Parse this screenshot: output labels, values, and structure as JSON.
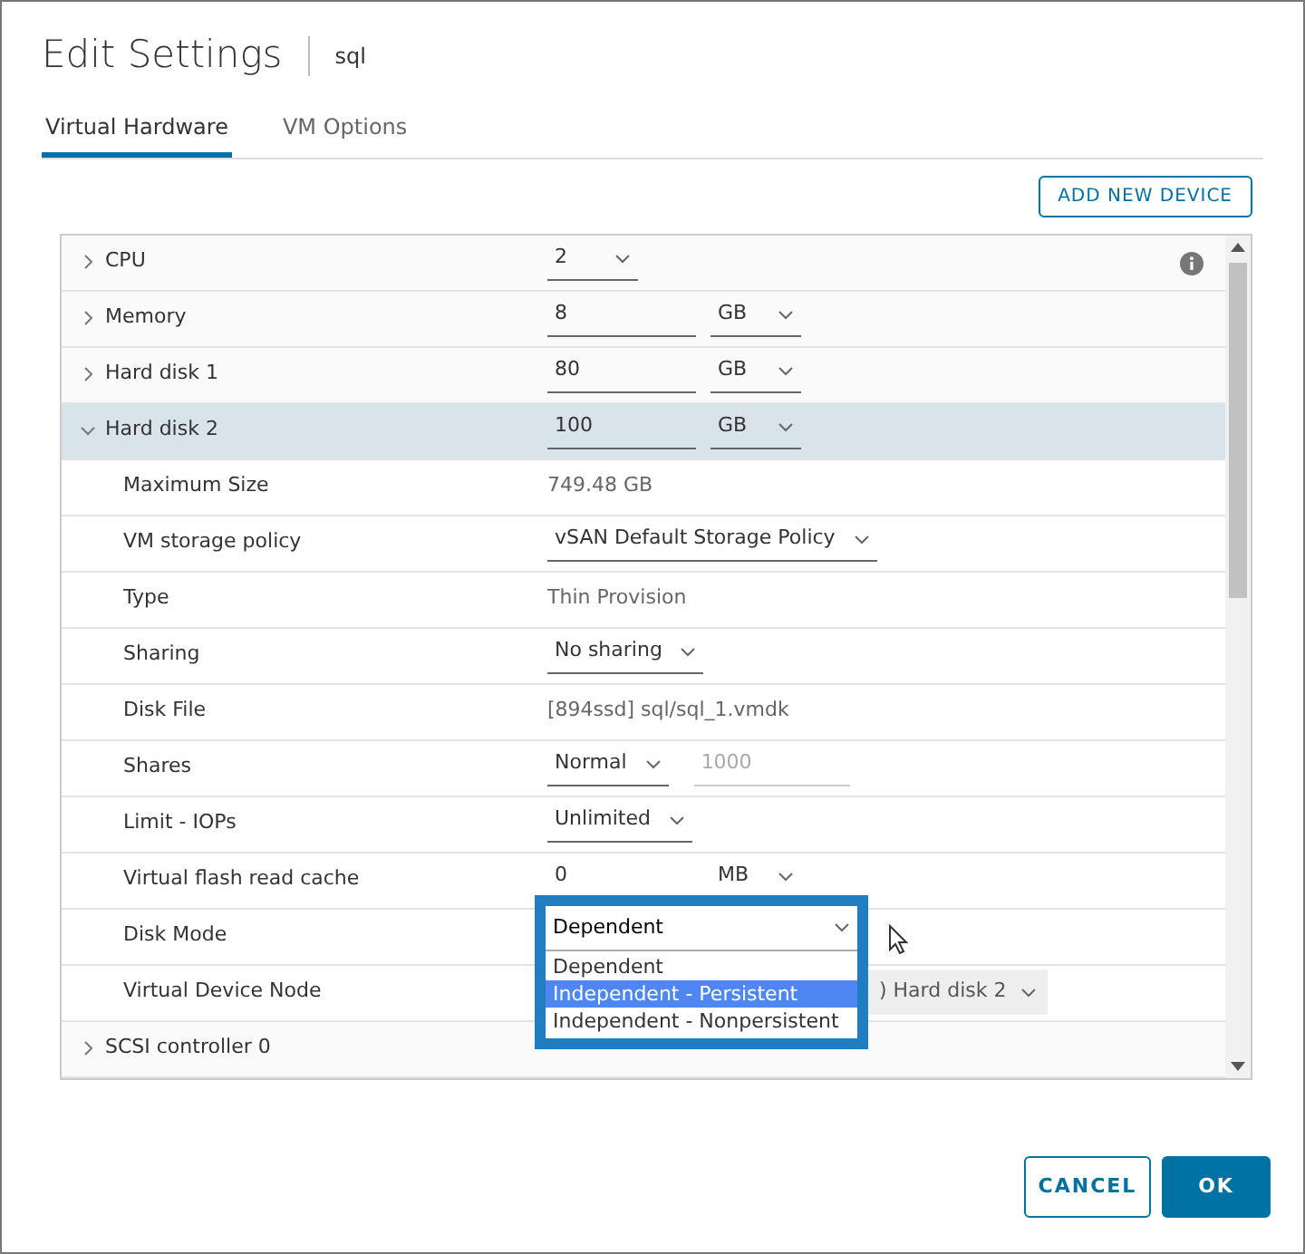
{
  "dialog": {
    "title": "Edit Settings",
    "subtitle": "sql"
  },
  "tabs": [
    {
      "label": "Virtual Hardware",
      "selected": true
    },
    {
      "label": "VM Options",
      "selected": false
    }
  ],
  "add_button": "ADD NEW DEVICE",
  "devices": [
    {
      "label": "CPU",
      "expanded": false,
      "selected": false,
      "info": true,
      "controls": [
        {
          "kind": "select",
          "value": "2"
        }
      ]
    },
    {
      "label": "Memory",
      "expanded": false,
      "selected": false,
      "controls": [
        {
          "kind": "input",
          "value": "8"
        },
        {
          "kind": "select",
          "value": "GB"
        }
      ]
    },
    {
      "label": "Hard disk 1",
      "expanded": false,
      "selected": false,
      "controls": [
        {
          "kind": "input",
          "value": "80"
        },
        {
          "kind": "select",
          "value": "GB"
        }
      ]
    },
    {
      "label": "Hard disk 2",
      "expanded": true,
      "selected": true,
      "controls": [
        {
          "kind": "input",
          "value": "100"
        },
        {
          "kind": "select",
          "value": "GB"
        }
      ],
      "children": [
        {
          "label": "Maximum Size",
          "controls": [
            {
              "kind": "text",
              "value": "749.48 GB"
            }
          ]
        },
        {
          "label": "VM storage policy",
          "controls": [
            {
              "kind": "select",
              "value": "vSAN Default Storage Policy"
            }
          ]
        },
        {
          "label": "Type",
          "controls": [
            {
              "kind": "text",
              "value": "Thin Provision"
            }
          ]
        },
        {
          "label": "Sharing",
          "controls": [
            {
              "kind": "select",
              "value": "No sharing"
            }
          ]
        },
        {
          "label": "Disk File",
          "controls": [
            {
              "kind": "text",
              "value": "[894ssd] sql/sql_1.vmdk"
            }
          ]
        },
        {
          "label": "Shares",
          "controls": [
            {
              "kind": "select",
              "value": "Normal"
            },
            {
              "kind": "disabled-input",
              "value": "1000"
            }
          ]
        },
        {
          "label": "Limit - IOPs",
          "controls": [
            {
              "kind": "select",
              "value": "Unlimited"
            }
          ]
        },
        {
          "label": "Virtual flash read cache",
          "controls": [
            {
              "kind": "plain",
              "value": "0"
            },
            {
              "kind": "plain-select",
              "value": "MB"
            }
          ]
        },
        {
          "label": "Disk Mode",
          "controls": [
            {
              "kind": "open-select",
              "value": "Dependent",
              "options": [
                {
                  "label": "Dependent",
                  "highlighted": false
                },
                {
                  "label": "Independent - Persistent",
                  "highlighted": true
                },
                {
                  "label": "Independent - Nonpersistent",
                  "highlighted": false
                }
              ]
            }
          ]
        },
        {
          "label": "Virtual Device Node",
          "controls": [
            {
              "kind": "covered-select",
              "value": ") Hard disk 2"
            }
          ]
        }
      ]
    },
    {
      "label": "SCSI controller 0",
      "expanded": false,
      "selected": false
    }
  ],
  "buttons": [
    {
      "label": "CANCEL",
      "kind": "secondary"
    },
    {
      "label": "OK",
      "kind": "primary"
    }
  ]
}
